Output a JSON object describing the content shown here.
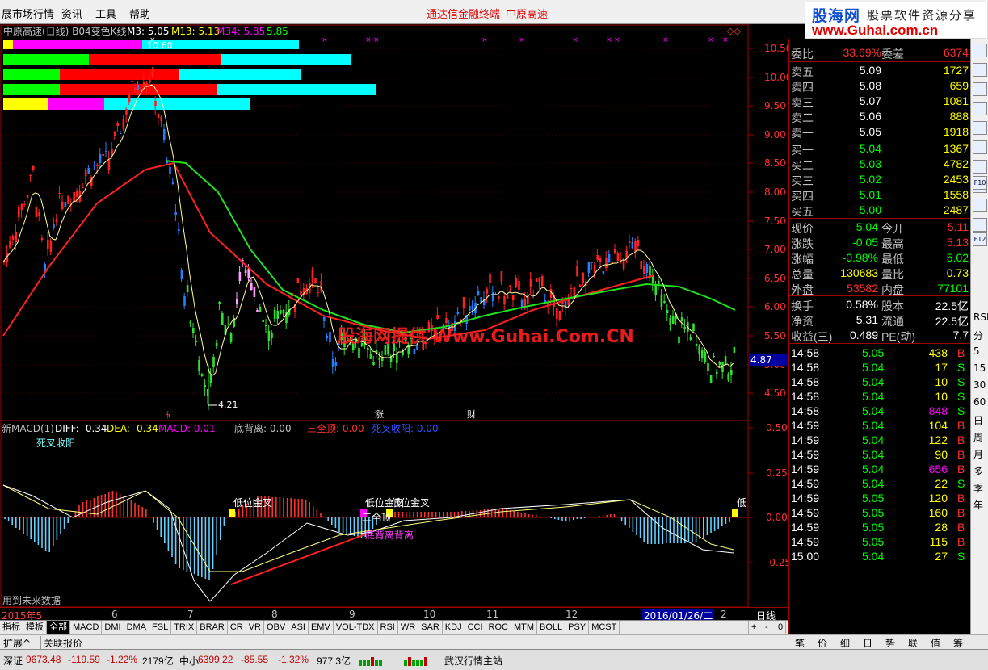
{
  "menu": {
    "app": "展市场行情",
    "items": [
      "资讯",
      "工具",
      "帮助"
    ],
    "headline1": "通达信金融终端",
    "headline2": "中原高速"
  },
  "logo": {
    "brand": "股海网",
    "tagline": "股票软件资源分享",
    "url": "www.Guhai.com.cn"
  },
  "main_chart": {
    "title": "中原高速(日线) B04变色K线",
    "m3": "M3: 5.05",
    "m13": "M13: 5.13",
    "m34": "M34: 5.85",
    "last": "5.85",
    "high_label": "10.60",
    "low_label": "4.21",
    "price_tag": "4.87",
    "watermark": "股海网提供 Www.Guhai.Com.CN",
    "marker_zhang": "涨",
    "marker_cai": "财",
    "marker_s": "$",
    "y_ticks": [
      "10.50",
      "10.00",
      "9.50",
      "9.00",
      "8.50",
      "8.00",
      "7.50",
      "7.00",
      "6.50",
      "6.00",
      "5.50",
      "5.00",
      "4.50"
    ]
  },
  "macd_panel": {
    "title": "新MACD(1)",
    "diff": "DIFF: -0.34",
    "dea": "DEA: -0.34",
    "macd": "MACD: 0.01",
    "bottom_div": "底背离: 0.00",
    "sanquan": "三全顶: 0.00",
    "sicha": "死叉收阳: 0.00",
    "label_sicha": "死叉收阳",
    "label_golden1": "低位金叉",
    "label_golden2": "低位金叉",
    "label_golden3": "低位金叉",
    "label_sanquan": "三全顶",
    "label_div": "底背离背离",
    "label_low": "低",
    "future_note": "用到未来数据",
    "y_ticks": [
      "0.50",
      "0.25",
      "0.00",
      "-0.25"
    ]
  },
  "date_axis": {
    "labels": [
      "2015年5",
      "6",
      "7",
      "8",
      "9",
      "10",
      "11",
      "12",
      "2016/01/26/二",
      "2"
    ],
    "period": "日线"
  },
  "tabs": [
    "指标",
    "模板",
    "全部",
    "MACD",
    "DMI",
    "DMA",
    "FSL",
    "TRIX",
    "BRAR",
    "CR",
    "VR",
    "OBV",
    "ASI",
    "EMV",
    "VOL-TDX",
    "RSI",
    "WR",
    "SAR",
    "KDJ",
    "CCI",
    "ROC",
    "MTM",
    "BOLL",
    "PSY",
    "MCST"
  ],
  "tabs_right": [
    "+",
    "-",
    "0"
  ],
  "ext": {
    "expand": "扩展^",
    "related": "关联报价"
  },
  "quote": {
    "weibi_label": "委比",
    "weibi": "33.69%",
    "weicha_label": "委差",
    "weicha": "6374",
    "sells": [
      {
        "l": "卖五",
        "p": "5.09",
        "v": "1727"
      },
      {
        "l": "卖四",
        "p": "5.08",
        "v": "659"
      },
      {
        "l": "卖三",
        "p": "5.07",
        "v": "1081"
      },
      {
        "l": "卖二",
        "p": "5.06",
        "v": "888"
      },
      {
        "l": "卖一",
        "p": "5.05",
        "v": "1918"
      }
    ],
    "buys": [
      {
        "l": "买一",
        "p": "5.04",
        "v": "1367"
      },
      {
        "l": "买二",
        "p": "5.03",
        "v": "4782"
      },
      {
        "l": "买三",
        "p": "5.02",
        "v": "2453"
      },
      {
        "l": "买四",
        "p": "5.01",
        "v": "1558"
      },
      {
        "l": "买五",
        "p": "5.00",
        "v": "2487"
      }
    ],
    "stats": [
      {
        "l1": "现价",
        "v1": "5.04",
        "l2": "今开",
        "v2": "5.11"
      },
      {
        "l1": "涨跌",
        "v1": "-0.05",
        "l2": "最高",
        "v2": "5.13"
      },
      {
        "l1": "涨幅",
        "v1": "-0.98%",
        "l2": "最低",
        "v2": "5.02"
      },
      {
        "l1": "总量",
        "v1": "130683",
        "l2": "量比",
        "v2": "0.73"
      },
      {
        "l1": "外盘",
        "v1": "53582",
        "l2": "内盘",
        "v2": "77101"
      }
    ],
    "stats2": [
      {
        "l1": "换手",
        "v1": "0.58%",
        "l2": "股本",
        "v2": "22.5亿"
      },
      {
        "l1": "净资",
        "v1": "5.31",
        "l2": "流通",
        "v2": "22.5亿"
      },
      {
        "l1": "收益(三)",
        "v1": "0.489",
        "l2": "PE(动)",
        "v2": "7.7"
      }
    ],
    "ticks": [
      {
        "t": "14:58",
        "p": "5.05",
        "v": "438",
        "s": "B"
      },
      {
        "t": "14:58",
        "p": "5.04",
        "v": "17",
        "s": "S"
      },
      {
        "t": "14:58",
        "p": "5.04",
        "v": "10",
        "s": "S"
      },
      {
        "t": "14:58",
        "p": "5.04",
        "v": "10",
        "s": "S"
      },
      {
        "t": "14:58",
        "p": "5.04",
        "v": "848",
        "s": "S"
      },
      {
        "t": "14:59",
        "p": "5.04",
        "v": "104",
        "s": "B"
      },
      {
        "t": "14:59",
        "p": "5.04",
        "v": "122",
        "s": "B"
      },
      {
        "t": "14:59",
        "p": "5.04",
        "v": "90",
        "s": "B"
      },
      {
        "t": "14:59",
        "p": "5.04",
        "v": "656",
        "s": "B"
      },
      {
        "t": "14:59",
        "p": "5.04",
        "v": "22",
        "s": "S"
      },
      {
        "t": "14:59",
        "p": "5.05",
        "v": "120",
        "s": "B"
      },
      {
        "t": "14:59",
        "p": "5.05",
        "v": "160",
        "s": "B"
      },
      {
        "t": "14:59",
        "p": "5.05",
        "v": "28",
        "s": "B"
      },
      {
        "t": "14:59",
        "p": "5.05",
        "v": "115",
        "s": "B"
      },
      {
        "t": "15:00",
        "p": "5.04",
        "v": "27",
        "s": "S"
      }
    ]
  },
  "bottom_tabs": [
    "笔",
    "价",
    "细",
    "日",
    "势",
    "联",
    "值",
    "筹"
  ],
  "sidebar_labels": [
    "RSI",
    "分",
    "5",
    "15",
    "30",
    "60",
    "日",
    "周",
    "月",
    "多",
    "季",
    "年"
  ],
  "sidebar_icons": [
    "F10",
    "F12"
  ],
  "status": {
    "sz_label": "深证",
    "sz": "9673.48",
    "sz_chg": "-119.59",
    "sz_pct": "-1.22%",
    "sz_amt": "2179亿",
    "zx_label": "中小",
    "zx": "6399.22",
    "zx_chg": "-85.55",
    "zx_pct": "-1.32%",
    "zx_amt": "977.3亿",
    "server": "武汉行情主站"
  }
}
